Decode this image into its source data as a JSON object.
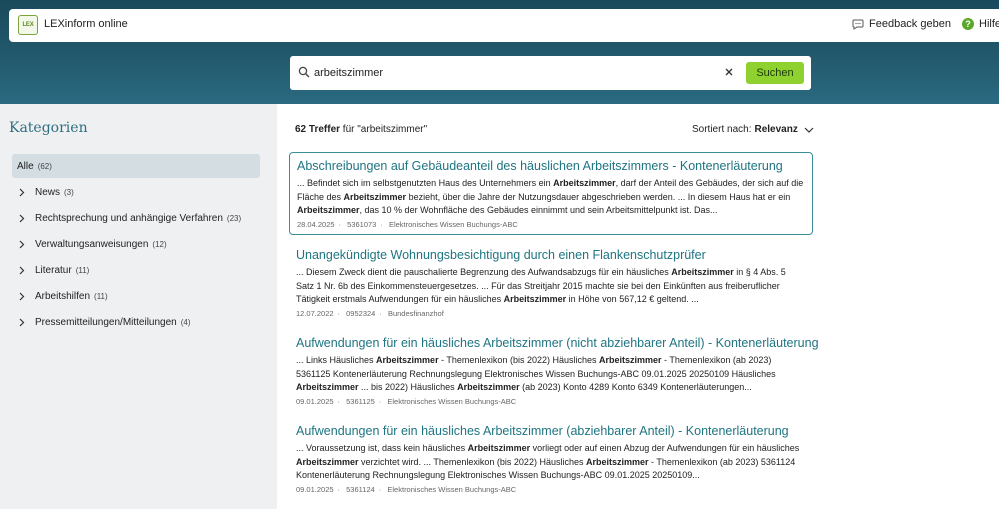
{
  "app": {
    "title": "LEXinform online",
    "logo_text": "LEX"
  },
  "topbar": {
    "feedback_label": "Feedback geben",
    "help_label": "Hilfe"
  },
  "search": {
    "query": "arbeitszimmer",
    "button_label": "Suchen"
  },
  "sidebar": {
    "title": "Kategorien",
    "all": {
      "label": "Alle",
      "count": "(62)"
    },
    "items": [
      {
        "label": "News",
        "count": "(3)"
      },
      {
        "label": "Rechtsprechung und anhängige Verfahren",
        "count": "(23)"
      },
      {
        "label": "Verwaltungsanweisungen",
        "count": "(12)"
      },
      {
        "label": "Literatur",
        "count": "(11)"
      },
      {
        "label": "Arbeitshilfen",
        "count": "(11)"
      },
      {
        "label": "Pressemitteilungen/Mitteilungen",
        "count": "(4)"
      }
    ]
  },
  "results_header": {
    "count": "62 Treffer",
    "suffix": " für \"arbeitszimmer\""
  },
  "sort": {
    "label": "Sortiert nach:",
    "value": "Relevanz"
  },
  "results": [
    {
      "title": "Abschreibungen auf Gebäudeanteil des häuslichen Arbeitszimmers - Kontenerläuterung",
      "snippet": "... Befindet sich im selbstgenutzten Haus des Unternehmers ein <b>Arbeitszimmer</b>, darf der Anteil des Gebäudes, der sich auf die Fläche des <b>Arbeitszimmer</b> bezieht, über die Jahre der Nutzungsdauer abgeschrieben werden. ... In diesem Haus hat er ein <b>Arbeitszimmer</b>, das 10 % der Wohnfläche des Gebäudes einnimmt und sein Arbeitsmittelpunkt ist. Das...",
      "date": "28.04.2025",
      "id": "5361073",
      "source": "Elektronisches Wissen Buchungs-ABC"
    },
    {
      "title": "Unangekündigte Wohnungsbesichtigung durch einen Flankenschutzprüfer",
      "snippet": "... Diesem Zweck dient die pauschalierte Begrenzung des Aufwandsabzugs für ein häusliches <b>Arbeitszimmer</b> in § 4 Abs. 5 Satz 1 Nr. 6b des Einkommensteuergesetzes. ... Für das Streitjahr 2015 machte sie bei den Einkünften aus freiberuflicher Tätigkeit erstmals Aufwendungen für ein häusliches <b>Arbeitszimmer</b> in Höhe von 567,12 € geltend. ...",
      "date": "12.07.2022",
      "id": "0952324",
      "source": "Bundesfinanzhof"
    },
    {
      "title": "Aufwendungen für ein häusliches Arbeitszimmer (nicht abziehbarer Anteil) - Kontenerläuterung",
      "snippet": "... Links Häusliches <b>Arbeitszimmer</b> - Themenlexikon (bis 2022) Häusliches <b>Arbeitszimmer</b> - Themenlexikon (ab 2023) 5361125 Kontenerläuterung Rechnungslegung Elektronisches Wissen Buchungs-ABC 09.01.2025 20250109 Häusliches <b>Arbeitszimmer</b> ... bis 2022) Häusliches <b>Arbeitszimmer</b> (ab 2023) Konto 4289 Konto 6349 Kontenerläuterungen...",
      "date": "09.01.2025",
      "id": "5361125",
      "source": "Elektronisches Wissen Buchungs-ABC"
    },
    {
      "title": "Aufwendungen für ein häusliches Arbeitszimmer (abziehbarer Anteil) - Kontenerläuterung",
      "snippet": "... Voraussetzung ist, dass kein häusliches <b>Arbeitszimmer</b> vorliegt oder auf einen Abzug der Aufwendungen für ein häusliches <b>Arbeitszimmer</b> verzichtet wird. ... Themenlexikon (bis 2022) Häusliches <b>Arbeitszimmer</b> - Themenlexikon (ab 2023) 5361124 Kontenerläuterung Rechnungslegung Elektronisches Wissen Buchungs-ABC 09.01.2025 20250109...",
      "date": "09.01.2025",
      "id": "5361124",
      "source": "Elektronisches Wissen Buchungs-ABC"
    }
  ]
}
